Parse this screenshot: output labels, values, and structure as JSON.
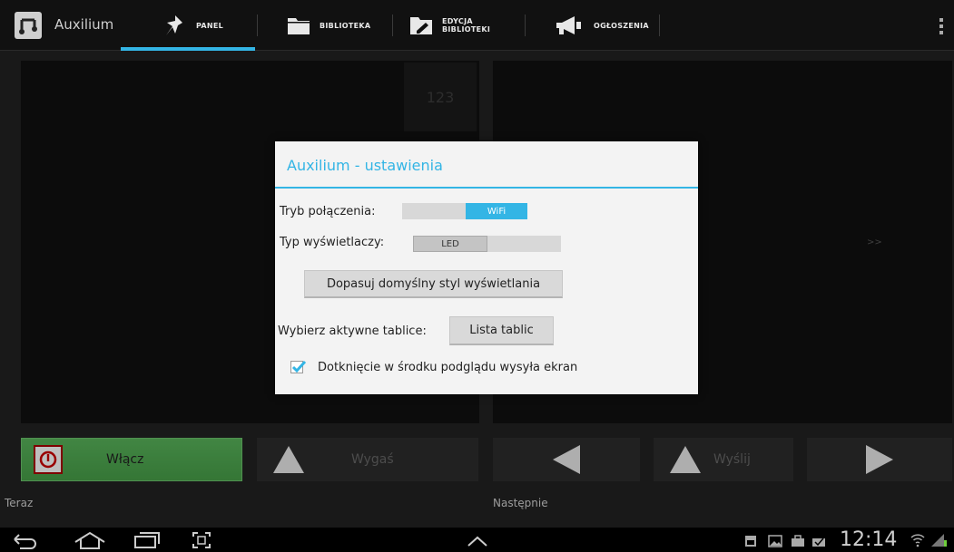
{
  "app": {
    "title": "Auxilium"
  },
  "tabs": [
    {
      "label": "PANEL",
      "icon": "pin-icon",
      "active": true
    },
    {
      "label": "BIBLIOTEKA",
      "icon": "folder-icon",
      "active": false
    },
    {
      "label_line1": "EDYCJA",
      "label_line2": "BIBLIOTEKI",
      "icon": "edit-folder-icon",
      "active": false
    },
    {
      "label": "OGŁOSZENIA",
      "icon": "megaphone-icon",
      "active": false
    }
  ],
  "colors": {
    "accent": "#33b5e5",
    "on_button": "#4caf50",
    "background": "#222222"
  },
  "panels": {
    "counter": "123",
    "next_arrow": ">>"
  },
  "buttons": {
    "on_label": "Włącz",
    "off_label": "Wygaś",
    "send_label": "Wyślij"
  },
  "captions": {
    "now": "Teraz",
    "next": "Następnie"
  },
  "dialog": {
    "title": "Auxilium - ustawienia",
    "connection_label": "Tryb połączenia:",
    "connection_value": "WiFi",
    "display_label": "Typ wyświetlaczy:",
    "display_value": "LED",
    "default_style_button": "Dopasuj domyślny styl wyświetlania",
    "boards_label": "Wybierz aktywne tablice:",
    "boards_button": "Lista tablic",
    "checkbox_label": "Dotknięcie w środku podglądu wysyła ekran",
    "checkbox_checked": true
  },
  "statusbar": {
    "time": "12:14"
  }
}
